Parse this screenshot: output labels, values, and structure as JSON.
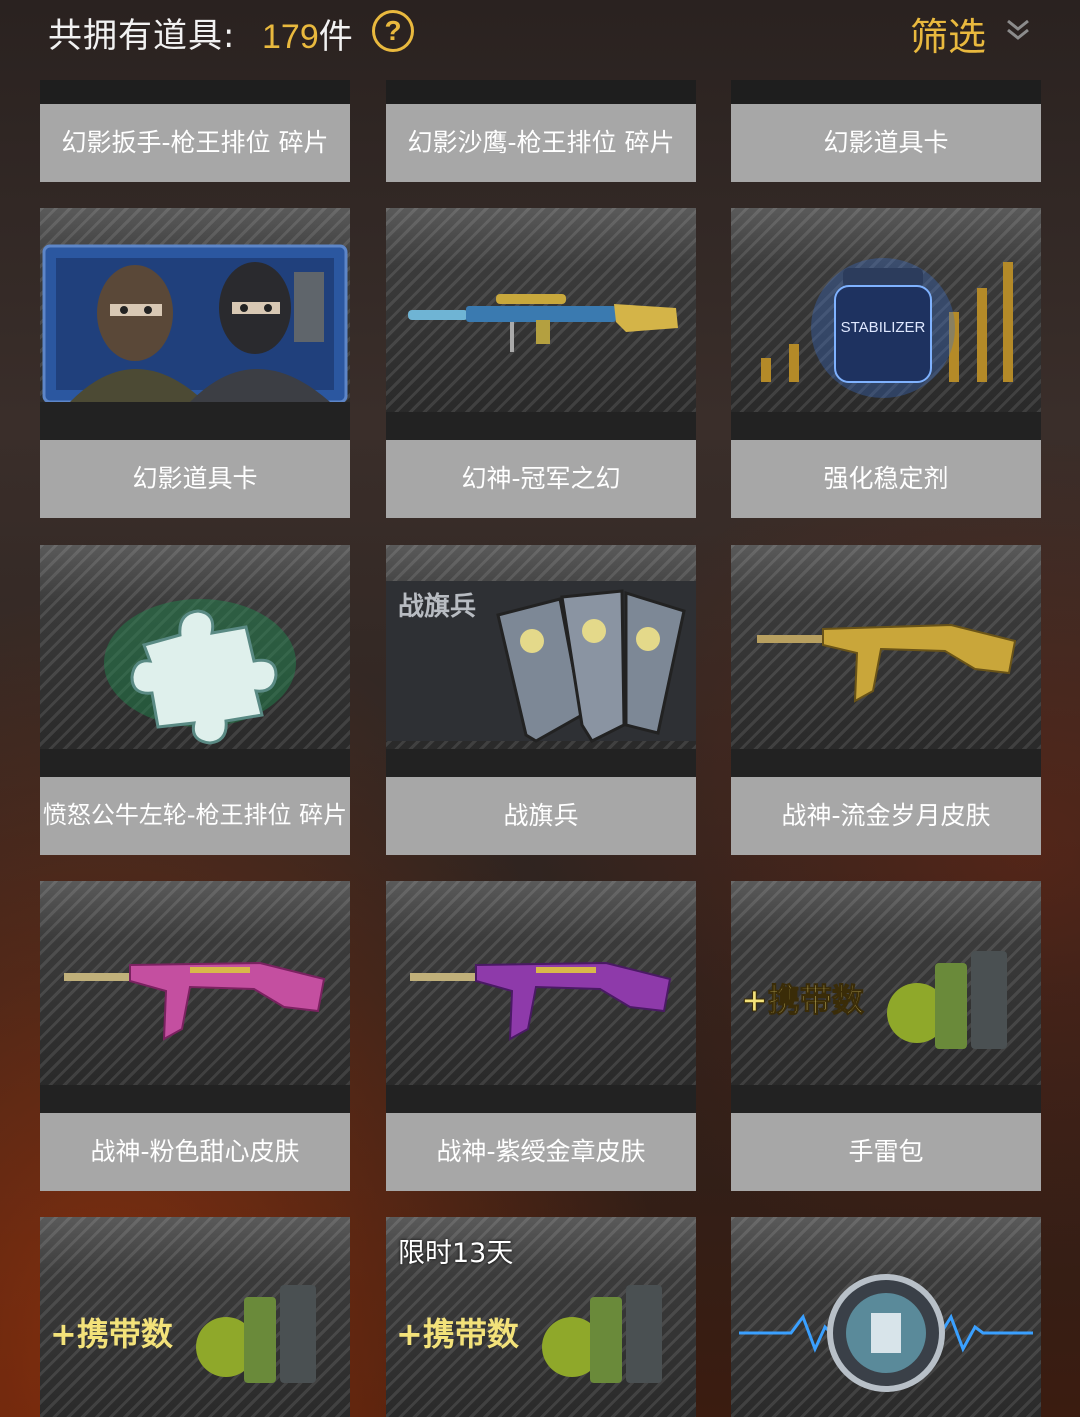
{
  "header": {
    "count_label": "共拥有道具:",
    "count_value": "179",
    "count_unit": "件",
    "help_glyph": "?",
    "filter_label": "筛选",
    "help_icon": "question-circle-icon",
    "filter_icon": "double-chevron-down-icon"
  },
  "colors": {
    "accent": "#e9b93e",
    "label_bg": "#a7a7a7"
  },
  "items": [
    {
      "label": "幻影扳手-枪王排位 碎片",
      "icon": "item-image"
    },
    {
      "label": "幻影沙鹰-枪王排位 碎片",
      "icon": "item-image"
    },
    {
      "label": "幻影道具卡",
      "icon": "item-image"
    },
    {
      "label": "幻影道具卡",
      "icon": "soldiers-card-image"
    },
    {
      "label": "幻神-冠军之幻",
      "icon": "sniper-rifle-image"
    },
    {
      "label": "强化稳定剂",
      "icon": "stabilizer-jar-image",
      "art_text": "STABILIZER"
    },
    {
      "label": "愤怒公牛左轮-枪王排位 碎片",
      "icon": "puzzle-piece-image"
    },
    {
      "label": "战旗兵",
      "icon": "banner-flags-image",
      "art_text": "战旗兵"
    },
    {
      "label": "战神-流金岁月皮肤",
      "icon": "gold-rifle-image"
    },
    {
      "label": "战神-粉色甜心皮肤",
      "icon": "pink-rifle-image"
    },
    {
      "label": "战神-紫绶金章皮肤",
      "icon": "purple-rifle-image"
    },
    {
      "label": "手雷包",
      "icon": "grenade-pack-image",
      "art_text": "+携带数"
    },
    {
      "label": "",
      "icon": "grenade-pack-image",
      "art_text": "+携带数"
    },
    {
      "label": "",
      "icon": "grenade-pack-image",
      "art_text": "+携带数",
      "timer": "限时13天"
    },
    {
      "label": "",
      "icon": "respawn-pulse-image"
    }
  ]
}
